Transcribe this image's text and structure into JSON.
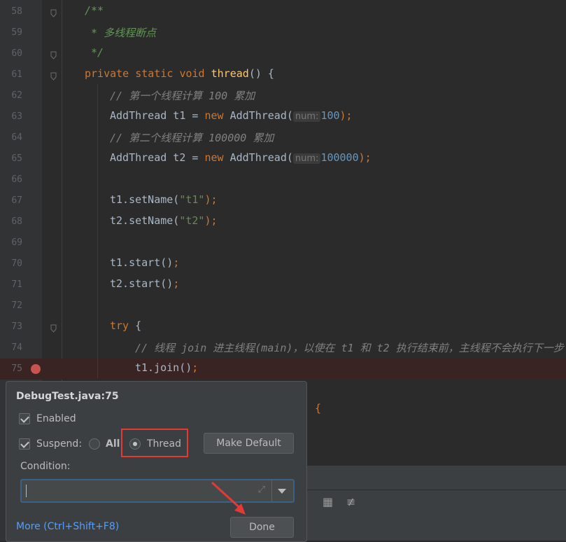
{
  "editor": {
    "lines": [
      {
        "num": "58",
        "indent": 121,
        "tokens": [
          {
            "t": "/**",
            "c": "doc"
          }
        ]
      },
      {
        "num": "59",
        "indent": 121,
        "tokens": [
          {
            "t": " * 多线程断点",
            "c": "doc"
          }
        ]
      },
      {
        "num": "60",
        "indent": 121,
        "tokens": [
          {
            "t": " */",
            "c": "doc"
          }
        ]
      },
      {
        "num": "61",
        "indent": 121,
        "tokens": [
          {
            "t": "private static void ",
            "c": "kw"
          },
          {
            "t": "thread",
            "c": "fn"
          },
          {
            "t": "() {",
            "c": ""
          }
        ]
      },
      {
        "num": "62",
        "indent": 157,
        "tokens": [
          {
            "t": "// 第一个线程计算 100 累加",
            "c": "cm"
          }
        ]
      },
      {
        "num": "63",
        "indent": 157,
        "tokens": [
          {
            "t": "AddThread t1 = ",
            "c": ""
          },
          {
            "t": "new ",
            "c": "kw"
          },
          {
            "t": "AddThread(",
            "c": ""
          },
          {
            "t": "num:",
            "c": "hint"
          },
          {
            "t": "100",
            "c": "num"
          },
          {
            "t": ");",
            "c": "kw"
          }
        ]
      },
      {
        "num": "64",
        "indent": 157,
        "tokens": [
          {
            "t": "// 第二个线程计算 100000 累加",
            "c": "cm"
          }
        ]
      },
      {
        "num": "65",
        "indent": 157,
        "tokens": [
          {
            "t": "AddThread t2 = ",
            "c": ""
          },
          {
            "t": "new ",
            "c": "kw"
          },
          {
            "t": "AddThread(",
            "c": ""
          },
          {
            "t": "num:",
            "c": "hint"
          },
          {
            "t": "100000",
            "c": "num"
          },
          {
            "t": ");",
            "c": "kw"
          }
        ]
      },
      {
        "num": "66",
        "indent": 157,
        "tokens": []
      },
      {
        "num": "67",
        "indent": 157,
        "tokens": [
          {
            "t": "t1.setName(",
            "c": ""
          },
          {
            "t": "\"t1\"",
            "c": "str"
          },
          {
            "t": ");",
            "c": "kw"
          }
        ]
      },
      {
        "num": "68",
        "indent": 157,
        "tokens": [
          {
            "t": "t2.setName(",
            "c": ""
          },
          {
            "t": "\"t2\"",
            "c": "str"
          },
          {
            "t": ");",
            "c": "kw"
          }
        ]
      },
      {
        "num": "69",
        "indent": 157,
        "tokens": []
      },
      {
        "num": "70",
        "indent": 157,
        "tokens": [
          {
            "t": "t1.start()",
            "c": ""
          },
          {
            "t": ";",
            "c": "kw"
          }
        ]
      },
      {
        "num": "71",
        "indent": 157,
        "tokens": [
          {
            "t": "t2.start()",
            "c": ""
          },
          {
            "t": ";",
            "c": "kw"
          }
        ]
      },
      {
        "num": "72",
        "indent": 157,
        "tokens": []
      },
      {
        "num": "73",
        "indent": 157,
        "tokens": [
          {
            "t": "try ",
            "c": "kw"
          },
          {
            "t": "{",
            "c": ""
          }
        ]
      },
      {
        "num": "74",
        "indent": 193,
        "tokens": [
          {
            "t": "// 线程 join 进主线程(main)，以使在 t1 和 t2 执行结束前，主线程不会执行下一步",
            "c": "cm"
          }
        ]
      },
      {
        "num": "75",
        "indent": 193,
        "tokens": [
          {
            "t": "t1.join()",
            "c": ""
          },
          {
            "t": ";",
            "c": "kw"
          }
        ]
      }
    ],
    "hidden_tail": ") {"
  },
  "popup": {
    "title": "DebugTest.java:75",
    "enabled_label": "Enabled",
    "suspend_label": "Suspend:",
    "all_label": "All",
    "thread_label": "Thread",
    "make_default_label": "Make Default",
    "condition_label": "Condition:",
    "condition_value": "",
    "more_label": "More (Ctrl+Shift+F8)",
    "done_label": "Done"
  },
  "colors": {
    "background": "#2b2b2b",
    "keyword": "#cc7832",
    "breakpoint": "#c75450",
    "highlight": "#e53935",
    "link": "#589df6"
  }
}
